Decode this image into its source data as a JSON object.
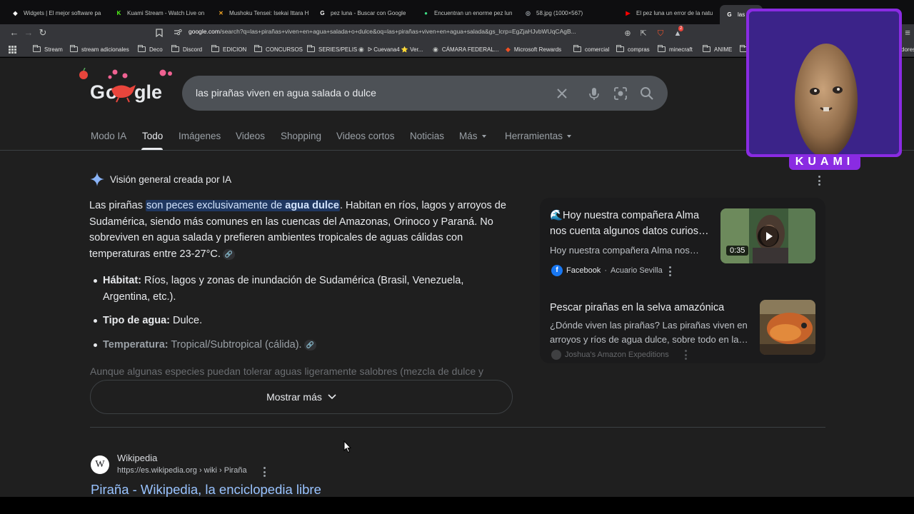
{
  "browser": {
    "tabs": [
      {
        "title": "Widgets | El mejor software pa",
        "favicon_color": "#ffffff",
        "favicon_char": "◆"
      },
      {
        "title": "Kuami Stream - Watch Live on",
        "favicon_color": "#53fc18",
        "favicon_char": "K"
      },
      {
        "title": "Mushoku Tensei: Isekai Ittara H",
        "favicon_color": "#f5a623",
        "favicon_char": "✕"
      },
      {
        "title": "pez luna - Buscar con Google",
        "favicon_color": "#ffffff",
        "favicon_char": "G"
      },
      {
        "title": "Encuentran un enorme pez lun",
        "favicon_color": "#3ddc84",
        "favicon_char": "●"
      },
      {
        "title": "58.jpg (1000×567)",
        "favicon_color": "#9aa0a6",
        "favicon_char": "◎"
      },
      {
        "title": "El pez luna un error de la natu",
        "favicon_color": "#ff0000",
        "favicon_char": "▶"
      },
      {
        "title": "las p",
        "favicon_color": "#ffffff",
        "favicon_char": "G"
      }
    ],
    "url_host": "google.com",
    "url_rest": "/search?q=las+pirañas+viven+en+agua+salada+o+dulce&oq=las+pirañas+viven+en+agua+salada&gs_lcrp=EgZjaHJvbWUqCAgB...",
    "extension_badge": "2",
    "bookmarks": [
      {
        "label": "Stream",
        "icon": "folder-icon"
      },
      {
        "label": "stream adicionales",
        "icon": "folder-icon"
      },
      {
        "label": "Deco",
        "icon": "folder-icon"
      },
      {
        "label": "Discord",
        "icon": "folder-icon"
      },
      {
        "label": "EDICION",
        "icon": "folder-icon"
      },
      {
        "label": "CONCURSOS",
        "icon": "folder-icon"
      },
      {
        "label": "SERIES/PELIS",
        "icon": "folder-icon"
      },
      {
        "label": "ᐅ Cuevana4 ⭐ Ver...",
        "icon": "site-icon"
      },
      {
        "label": "CÁMARA FEDERAL...",
        "icon": "site-icon"
      },
      {
        "label": "Microsoft Rewards",
        "icon": "rewards-icon"
      },
      {
        "label": "comercial",
        "icon": "folder-icon"
      },
      {
        "label": "compras",
        "icon": "folder-icon"
      },
      {
        "label": "minecraft",
        "icon": "folder-icon"
      },
      {
        "label": "ANIME",
        "icon": "folder-icon"
      },
      {
        "label": "dores",
        "icon": "folder-icon"
      }
    ]
  },
  "search": {
    "query": "las pirañas viven en agua salada o dulce",
    "tabs": [
      "Modo IA",
      "Todo",
      "Imágenes",
      "Videos",
      "Shopping",
      "Videos cortos",
      "Noticias",
      "Más",
      "Herramientas"
    ],
    "active_tab": "Todo"
  },
  "ai_overview": {
    "header": "Visión general creada por IA",
    "p1_before": "Las pirañas ",
    "p1_highlight_a": "son peces exclusivamente de ",
    "p1_highlight_b": "agua dulce",
    "p1_after": ". Habitan en ríos, lagos y arroyos de Sudamérica, siendo más comunes en las cuencas del Amazonas, Orinoco y Paraná. No sobreviven en agua salada y prefieren ambientes tropicales de aguas cálidas con temperaturas entre 23-27°C.",
    "bullets": [
      {
        "label": "Hábitat:",
        "text": " Ríos, lagos y zonas de inundación de Sudamérica (Brasil, Venezuela, Argentina, etc.)."
      },
      {
        "label": "Tipo de agua:",
        "text": " Dulce."
      },
      {
        "label": "Temperatura:",
        "text": " Tropical/Subtropical (cálida)."
      }
    ],
    "faded_line": "Aunque algunas especies puedan tolerar aguas ligeramente salobres (mezcla de dulce y",
    "show_more": "Mostrar más"
  },
  "side_cards": [
    {
      "title": "🌊Hoy nuestra compañera Alma nos cuenta algunos datos curios…",
      "snippet": "Hoy nuestra compañera Alma nos…",
      "source": "Facebook",
      "source_sub": "Acuario Sevilla",
      "duration": "0:35"
    },
    {
      "title": "Pescar pirañas en la selva amazónica",
      "snippet": "¿Dónde viven las pirañas? Las pirañas viven en arroyos y ríos de agua dulce, sobre todo en la…",
      "source": "Joshua's Amazon Expeditions"
    }
  ],
  "result": {
    "site_name": "Wikipedia",
    "url": "https://es.wikipedia.org › wiki › Piraña",
    "title": "Piraña - Wikipedia, la enciclopedia libre"
  },
  "overlay": {
    "name": "KUAMI"
  },
  "colors": {
    "page_bg": "#1f1f1f",
    "link": "#99c3ff",
    "highlight": "#1f3760",
    "overlay_purple": "#8a2be2"
  }
}
